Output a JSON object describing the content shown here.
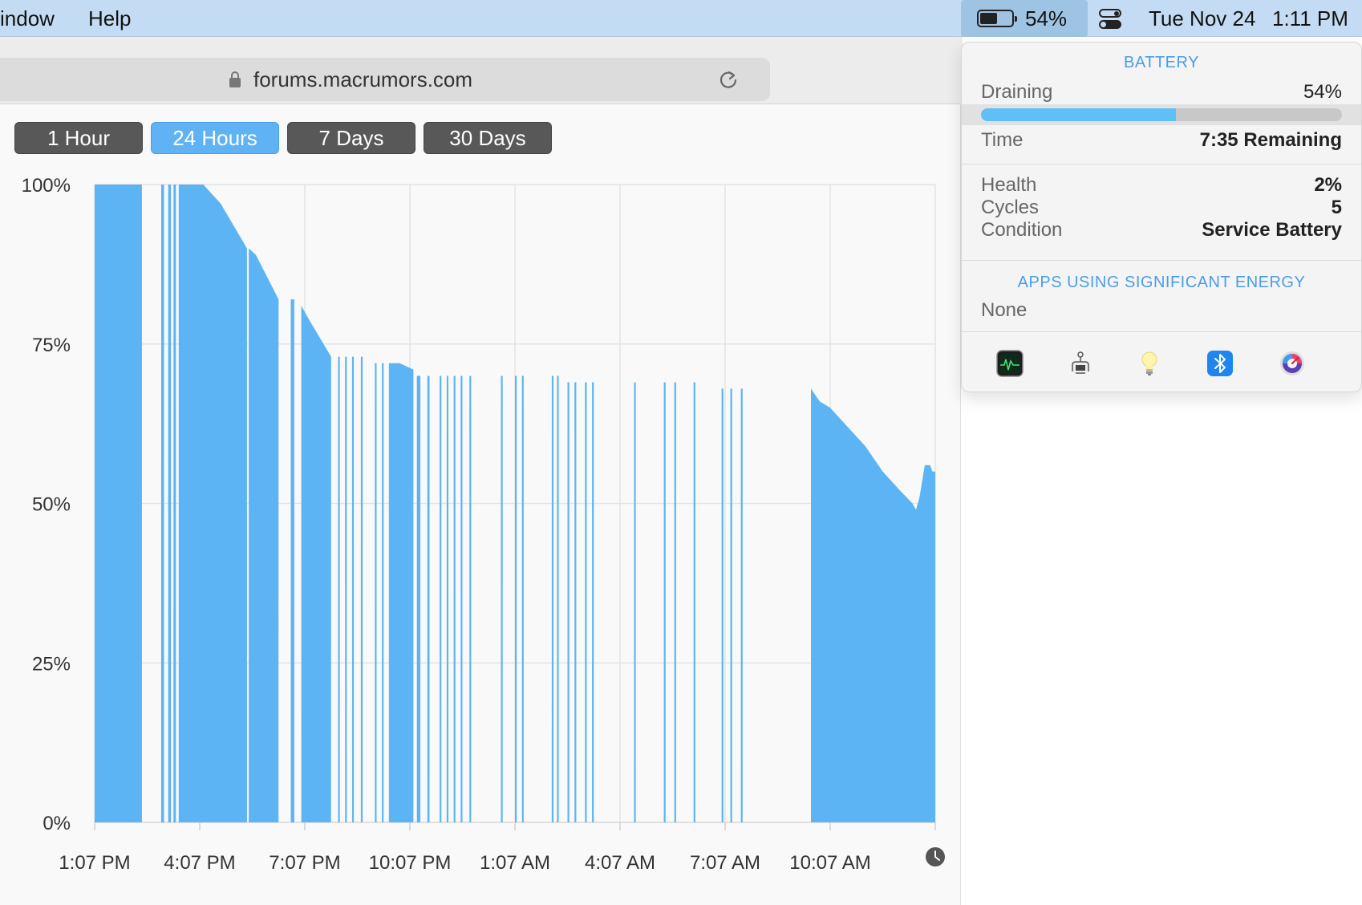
{
  "menubar": {
    "items": [
      "indow",
      "Help"
    ],
    "battery_percent": "54%",
    "battery_level": 0.54,
    "date": "Tue Nov 24",
    "time": "1:11 PM"
  },
  "browser": {
    "url": "forums.macrumors.com"
  },
  "history": {
    "range_buttons": [
      "1 Hour",
      "24 Hours",
      "7 Days",
      "30 Days"
    ],
    "active_range": "24 Hours"
  },
  "chart_data": {
    "type": "area",
    "x_tick_labels": [
      "1:07 PM",
      "4:07 PM",
      "7:07 PM",
      "10:07 PM",
      "1:07 AM",
      "4:07 AM",
      "7:07 AM",
      "10:07 AM"
    ],
    "y_tick_labels": [
      "100%",
      "75%",
      "50%",
      "25%",
      "0%"
    ],
    "ylim": [
      0,
      100
    ],
    "xlim_hours": [
      0,
      24
    ],
    "grid": true,
    "fill_color": "#5db4f4",
    "segments": [
      {
        "x_start": 0.0,
        "x_end": 1.35,
        "points": [
          [
            0.0,
            100
          ],
          [
            1.35,
            100
          ]
        ]
      },
      {
        "x_start": 1.9,
        "x_end": 1.98,
        "points": [
          [
            1.9,
            100
          ],
          [
            1.98,
            100
          ]
        ]
      },
      {
        "x_start": 2.1,
        "x_end": 2.18,
        "points": [
          [
            2.1,
            100
          ],
          [
            2.18,
            100
          ]
        ]
      },
      {
        "x_start": 2.25,
        "x_end": 2.32,
        "points": [
          [
            2.25,
            100
          ],
          [
            2.32,
            100
          ]
        ]
      },
      {
        "x_start": 2.4,
        "x_end": 4.35,
        "points": [
          [
            2.4,
            100
          ],
          [
            3.1,
            100
          ],
          [
            3.6,
            97
          ],
          [
            4.35,
            90
          ]
        ]
      },
      {
        "x_start": 4.4,
        "x_end": 5.25,
        "points": [
          [
            4.4,
            90
          ],
          [
            4.6,
            89
          ],
          [
            5.25,
            82
          ]
        ]
      },
      {
        "x_start": 5.6,
        "x_end": 5.7,
        "points": [
          [
            5.6,
            82
          ],
          [
            5.7,
            82
          ]
        ]
      },
      {
        "x_start": 5.9,
        "x_end": 6.75,
        "points": [
          [
            5.9,
            81
          ],
          [
            6.1,
            79
          ],
          [
            6.75,
            73
          ]
        ]
      },
      {
        "x_start": 6.95,
        "x_end": 7.0,
        "points": [
          [
            6.95,
            73
          ],
          [
            7.0,
            73
          ]
        ]
      },
      {
        "x_start": 7.15,
        "x_end": 7.2,
        "points": [
          [
            7.15,
            73
          ],
          [
            7.2,
            73
          ]
        ]
      },
      {
        "x_start": 7.35,
        "x_end": 7.4,
        "points": [
          [
            7.35,
            73
          ],
          [
            7.4,
            73
          ]
        ]
      },
      {
        "x_start": 7.6,
        "x_end": 7.65,
        "points": [
          [
            7.6,
            73
          ],
          [
            7.65,
            73
          ]
        ]
      },
      {
        "x_start": 8.0,
        "x_end": 8.05,
        "points": [
          [
            8.0,
            72
          ],
          [
            8.05,
            72
          ]
        ]
      },
      {
        "x_start": 8.2,
        "x_end": 8.25,
        "points": [
          [
            8.2,
            72
          ],
          [
            8.25,
            72
          ]
        ]
      },
      {
        "x_start": 8.4,
        "x_end": 9.1,
        "points": [
          [
            8.4,
            72
          ],
          [
            8.7,
            72
          ],
          [
            9.1,
            71
          ]
        ]
      },
      {
        "x_start": 9.2,
        "x_end": 9.3,
        "points": [
          [
            9.2,
            70
          ],
          [
            9.3,
            70
          ]
        ]
      },
      {
        "x_start": 9.5,
        "x_end": 9.56,
        "points": [
          [
            9.5,
            70
          ],
          [
            9.56,
            70
          ]
        ]
      },
      {
        "x_start": 9.85,
        "x_end": 9.9,
        "points": [
          [
            9.85,
            70
          ],
          [
            9.9,
            70
          ]
        ]
      },
      {
        "x_start": 10.05,
        "x_end": 10.1,
        "points": [
          [
            10.05,
            70
          ],
          [
            10.1,
            70
          ]
        ]
      },
      {
        "x_start": 10.25,
        "x_end": 10.3,
        "points": [
          [
            10.25,
            70
          ],
          [
            10.3,
            70
          ]
        ]
      },
      {
        "x_start": 10.45,
        "x_end": 10.5,
        "points": [
          [
            10.45,
            70
          ],
          [
            10.5,
            70
          ]
        ]
      },
      {
        "x_start": 10.7,
        "x_end": 10.75,
        "points": [
          [
            10.7,
            70
          ],
          [
            10.75,
            70
          ]
        ]
      },
      {
        "x_start": 11.6,
        "x_end": 11.65,
        "points": [
          [
            11.6,
            70
          ],
          [
            11.65,
            70
          ]
        ]
      },
      {
        "x_start": 12.0,
        "x_end": 12.05,
        "points": [
          [
            12.0,
            70
          ],
          [
            12.05,
            70
          ]
        ]
      },
      {
        "x_start": 12.2,
        "x_end": 12.25,
        "points": [
          [
            12.2,
            70
          ],
          [
            12.25,
            70
          ]
        ]
      },
      {
        "x_start": 13.05,
        "x_end": 13.1,
        "points": [
          [
            13.05,
            70
          ],
          [
            13.1,
            70
          ]
        ]
      },
      {
        "x_start": 13.2,
        "x_end": 13.25,
        "points": [
          [
            13.2,
            70
          ],
          [
            13.25,
            70
          ]
        ]
      },
      {
        "x_start": 13.5,
        "x_end": 13.55,
        "points": [
          [
            13.5,
            69
          ],
          [
            13.55,
            69
          ]
        ]
      },
      {
        "x_start": 13.7,
        "x_end": 13.75,
        "points": [
          [
            13.7,
            69
          ],
          [
            13.75,
            69
          ]
        ]
      },
      {
        "x_start": 14.0,
        "x_end": 14.05,
        "points": [
          [
            14.0,
            69
          ],
          [
            14.05,
            69
          ]
        ]
      },
      {
        "x_start": 14.2,
        "x_end": 14.25,
        "points": [
          [
            14.2,
            69
          ],
          [
            14.25,
            69
          ]
        ]
      },
      {
        "x_start": 15.4,
        "x_end": 15.45,
        "points": [
          [
            15.4,
            69
          ],
          [
            15.45,
            69
          ]
        ]
      },
      {
        "x_start": 16.25,
        "x_end": 16.3,
        "points": [
          [
            16.25,
            69
          ],
          [
            16.3,
            69
          ]
        ]
      },
      {
        "x_start": 16.55,
        "x_end": 16.6,
        "points": [
          [
            16.55,
            69
          ],
          [
            16.6,
            69
          ]
        ]
      },
      {
        "x_start": 17.1,
        "x_end": 17.15,
        "points": [
          [
            17.1,
            69
          ],
          [
            17.15,
            69
          ]
        ]
      },
      {
        "x_start": 17.9,
        "x_end": 17.95,
        "points": [
          [
            17.9,
            68
          ],
          [
            17.95,
            68
          ]
        ]
      },
      {
        "x_start": 18.15,
        "x_end": 18.2,
        "points": [
          [
            18.15,
            68
          ],
          [
            18.2,
            68
          ]
        ]
      },
      {
        "x_start": 18.45,
        "x_end": 18.5,
        "points": [
          [
            18.45,
            68
          ],
          [
            18.5,
            68
          ]
        ]
      },
      {
        "x_start": 20.45,
        "x_end": 24.0,
        "points": [
          [
            20.45,
            68
          ],
          [
            20.7,
            66
          ],
          [
            21.0,
            65
          ],
          [
            21.5,
            62
          ],
          [
            22.0,
            59
          ],
          [
            22.5,
            55
          ],
          [
            23.0,
            52
          ],
          [
            23.35,
            50
          ],
          [
            23.45,
            49
          ],
          [
            23.55,
            51
          ],
          [
            23.7,
            56
          ],
          [
            23.85,
            56
          ],
          [
            23.92,
            55
          ],
          [
            24.0,
            55
          ]
        ]
      }
    ]
  },
  "battery_menu": {
    "header": "BATTERY",
    "draining_label": "Draining",
    "draining_value": "54%",
    "level": 0.54,
    "time_label": "Time",
    "time_value": "7:35 Remaining",
    "health_label": "Health",
    "health_value": "2%",
    "cycles_label": "Cycles",
    "cycles_value": "5",
    "condition_label": "Condition",
    "condition_value": "Service Battery",
    "apps_header": "APPS USING SIGNIFICANT ENERGY",
    "apps_value": "None",
    "app_icons": [
      "activity-monitor-icon",
      "system-information-icon",
      "lightbulb-icon",
      "bluetooth-icon",
      "istat-menus-icon"
    ]
  }
}
